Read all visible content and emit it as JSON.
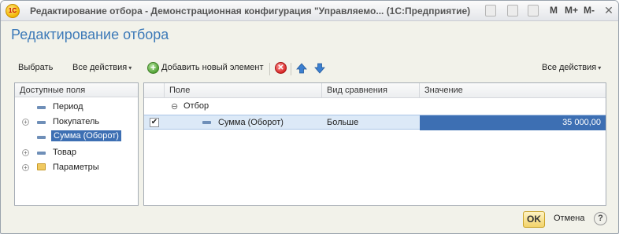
{
  "window": {
    "logo_text": "1С",
    "title": "Редактирование отбора - Демонстрационная конфигурация \"Управляемо... (1С:Предприятие)",
    "mem_buttons": [
      "M",
      "M+",
      "M-"
    ],
    "close_glyph": "✕"
  },
  "form": {
    "title": "Редактирование отбора"
  },
  "toolbar": {
    "select_label": "Выбрать",
    "all_actions_label": "Все действия",
    "add_label": "Добавить новый элемент",
    "right_all_actions_label": "Все действия",
    "caret": "▾",
    "icons": {
      "add": "plus-circle-icon",
      "delete": "delete-circle-icon",
      "up": "arrow-up-icon",
      "down": "arrow-down-icon"
    },
    "colors": {
      "add": "#4c9d2f",
      "delete": "#d62020",
      "arrows": "#3b7fd0"
    }
  },
  "left_panel": {
    "header": "Доступные поля",
    "items": [
      {
        "label": "Период",
        "expandable": false,
        "icon": "field-icon",
        "selected": false
      },
      {
        "label": "Покупатель",
        "expandable": true,
        "icon": "field-icon",
        "selected": false
      },
      {
        "label": "Сумма (Оборот)",
        "expandable": false,
        "icon": "field-icon",
        "selected": true
      },
      {
        "label": "Товар",
        "expandable": true,
        "icon": "field-icon",
        "selected": false
      },
      {
        "label": "Параметры",
        "expandable": true,
        "icon": "folder-icon",
        "selected": false
      }
    ]
  },
  "grid": {
    "columns": [
      "Поле",
      "Вид сравнения",
      "Значение"
    ],
    "group_row": {
      "label": "Отбор",
      "expander": "⊖"
    },
    "rows": [
      {
        "checked": true,
        "field": "Сумма (Оборот)",
        "comparison": "Больше",
        "value": "35 000,00"
      }
    ]
  },
  "footer": {
    "ok_label": "OK",
    "cancel_label": "Отмена",
    "help_label": "?"
  },
  "colors": {
    "accent_title": "#3d7ab8",
    "selection": "#3d6fb3",
    "selected_row": "#dce9f7",
    "ok_button": "#f2d36b"
  }
}
